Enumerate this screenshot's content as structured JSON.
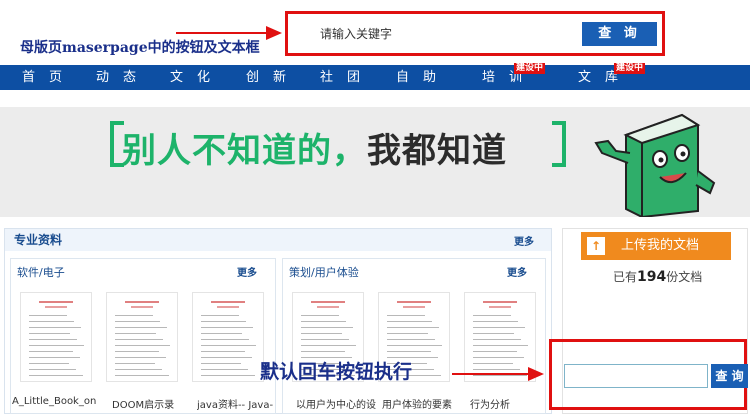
{
  "annotations": {
    "top": "母版页maserpage中的按钮及文本框",
    "bottom": "默认回车按钮执行"
  },
  "search": {
    "input_value": "请输入关键字",
    "button_label": "查 询"
  },
  "nav": {
    "items": [
      {
        "label": "首页"
      },
      {
        "label": "动态"
      },
      {
        "label": "文化"
      },
      {
        "label": "创新"
      },
      {
        "label": "社团"
      },
      {
        "label": "自助"
      },
      {
        "label": "培训",
        "badge": "建设中"
      },
      {
        "label": "文库",
        "badge": "建设中"
      }
    ]
  },
  "banner": {
    "text_part1": "别人不知道的，",
    "text_part2": "我都知道"
  },
  "professional": {
    "title": "专业资料",
    "more": "更多",
    "categories": [
      {
        "title": "软件/电子",
        "more": "更多",
        "docs": [
          "A_Little_Book_on",
          "DOOM启示录",
          "java资料-- Java--"
        ]
      },
      {
        "title": "策划/用户体验",
        "more": "更多",
        "docs": [
          "以用户为中心的设",
          "用户体验的要素",
          "行为分析"
        ]
      }
    ]
  },
  "side": {
    "upload_label": "上传我的文档",
    "count_prefix": "已有",
    "count_value": "194",
    "count_suffix": "份文档",
    "enter_button_label": "查 询"
  },
  "colors": {
    "nav_bg": "#0d4fa3",
    "accent_red": "#e01010",
    "button_blue": "#1a5fb4",
    "upload_orange": "#f08a1e",
    "banner_green": "#1db36a"
  }
}
